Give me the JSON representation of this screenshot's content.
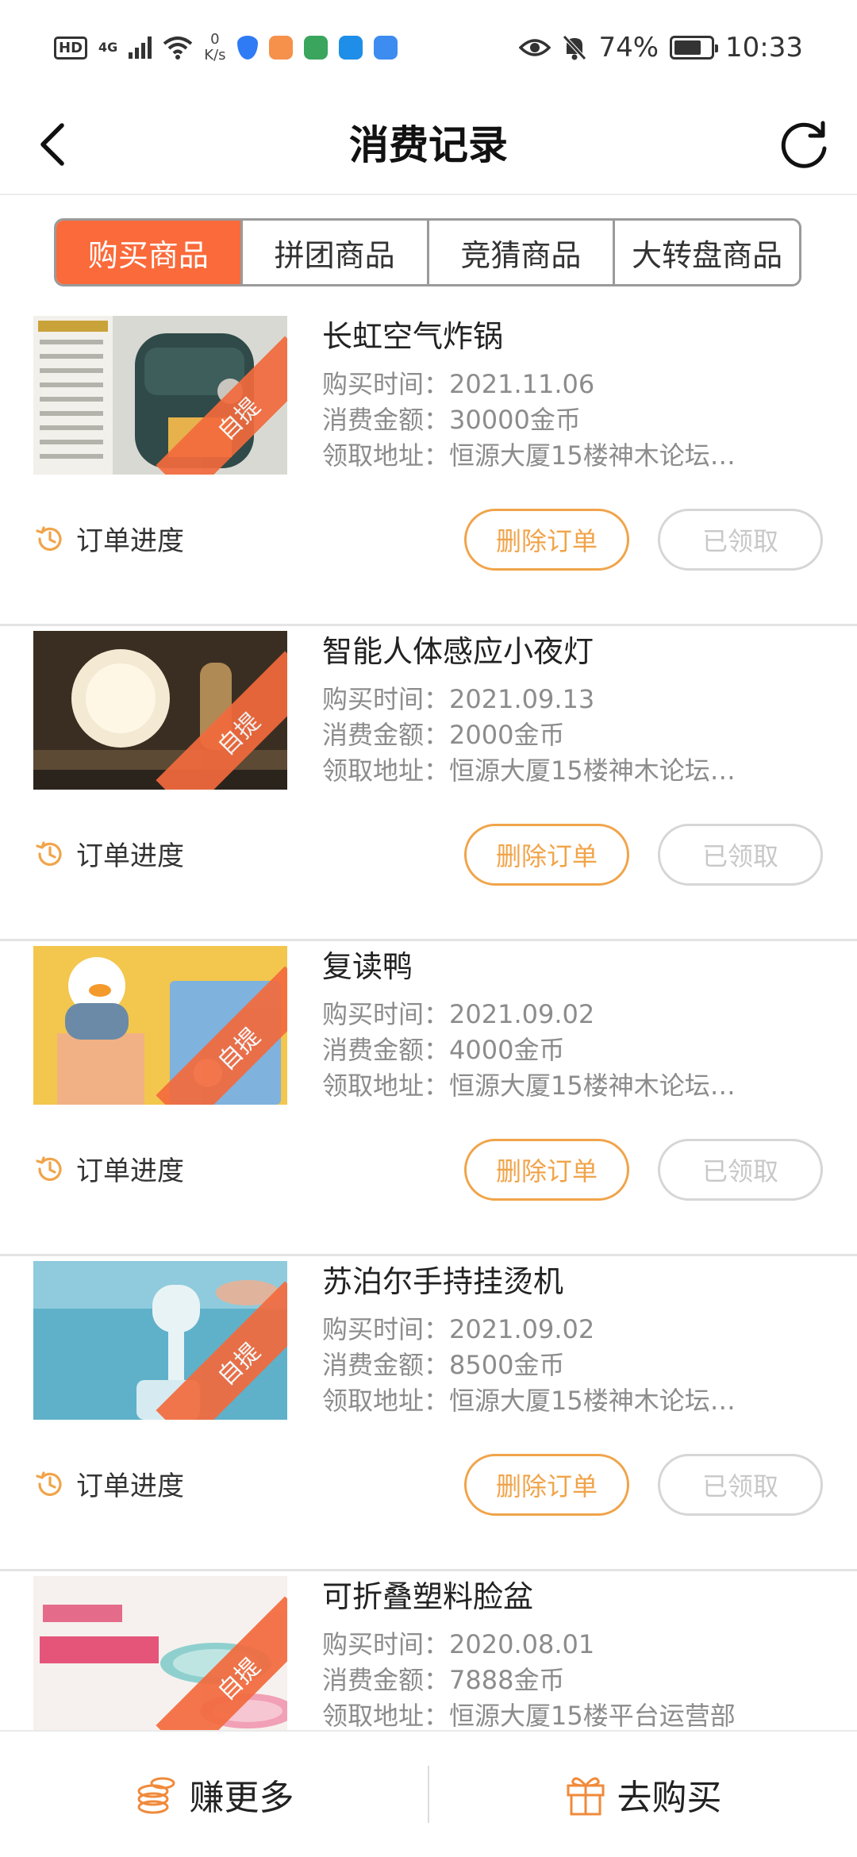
{
  "status_bar": {
    "hd": "HD",
    "network": "4G",
    "speed_value": "0",
    "speed_unit": "K/s",
    "battery": "74%",
    "battery_level": 0.74,
    "time": "10:33"
  },
  "header": {
    "title": "消费记录"
  },
  "tabs": [
    {
      "label": "购买商品",
      "active": true
    },
    {
      "label": "拼团商品",
      "active": false
    },
    {
      "label": "竞猜商品",
      "active": false
    },
    {
      "label": "大转盘商品",
      "active": false
    }
  ],
  "labels": {
    "time": "购买时间：",
    "amount": "消费金额：",
    "address": "领取地址：",
    "order_progress": "订单进度",
    "delete_order": "删除订单",
    "received": "已领取",
    "pickup_badge": "自提"
  },
  "orders": [
    {
      "name": "长虹空气炸锅",
      "time": "2021.11.06",
      "amount": "30000金币",
      "address": "恒源大厦15楼神木论坛…"
    },
    {
      "name": "智能人体感应小夜灯",
      "time": "2021.09.13",
      "amount": "2000金币",
      "address": "恒源大厦15楼神木论坛…"
    },
    {
      "name": "复读鸭",
      "time": "2021.09.02",
      "amount": "4000金币",
      "address": "恒源大厦15楼神木论坛…"
    },
    {
      "name": "苏泊尔手持挂烫机",
      "time": "2021.09.02",
      "amount": "8500金币",
      "address": "恒源大厦15楼神木论坛…"
    },
    {
      "name": "可折叠塑料脸盆",
      "time": "2020.08.01",
      "amount": "7888金币",
      "address": "恒源大厦15楼平台运营部"
    }
  ],
  "bottom_bar": {
    "earn_more": "赚更多",
    "go_buy": "去购买"
  },
  "colors": {
    "accent": "#fb6a3a",
    "delete_button": "#f0a44a",
    "disabled": "#c8c8c8"
  }
}
